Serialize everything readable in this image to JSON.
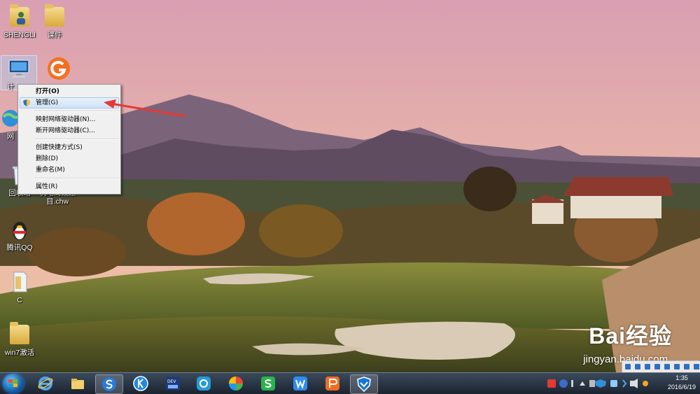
{
  "desktop": {
    "icons": [
      {
        "label": "SHENGLI"
      },
      {
        "label": "课件"
      },
      {
        "label": "计"
      },
      {
        "label": "网"
      },
      {
        "label": "回收站"
      },
      {
        "label": "杭电离线题目.chw"
      },
      {
        "label": "腾讯QQ"
      },
      {
        "label": "C"
      },
      {
        "label": "win7激活"
      }
    ]
  },
  "context_menu": {
    "items": [
      {
        "label": "打开(O)"
      },
      {
        "label": "管理(G)"
      },
      {
        "label": "映射网络驱动器(N)..."
      },
      {
        "label": "断开网络驱动器(C)..."
      },
      {
        "label": "创建快捷方式(S)"
      },
      {
        "label": "删除(D)"
      },
      {
        "label": "重命名(M)"
      },
      {
        "label": "属性(R)"
      }
    ]
  },
  "watermark": {
    "brand": "Bai经验",
    "url": "jingyan.baidu.com"
  },
  "taskbar": {
    "apps": [
      {
        "icon": "internet-explorer-icon"
      },
      {
        "icon": "file-explorer-icon"
      },
      {
        "icon": "sogou-browser-icon"
      },
      {
        "icon": "k-app-icon"
      },
      {
        "icon": "dev-cpp-icon"
      },
      {
        "icon": "qq-games-icon"
      },
      {
        "icon": "pinwheel-icon"
      },
      {
        "icon": "wps-spreadsheet-icon"
      },
      {
        "icon": "wps-writer-icon"
      },
      {
        "icon": "wps-presentation-icon"
      },
      {
        "icon": "security-shield-icon"
      }
    ],
    "clock": {
      "time": "1:35",
      "date": "2016/6/19"
    }
  },
  "colors": {
    "arrow": "#e53935",
    "menu_bg": "#f0f0f0",
    "taskbar": "#1f2a38"
  }
}
